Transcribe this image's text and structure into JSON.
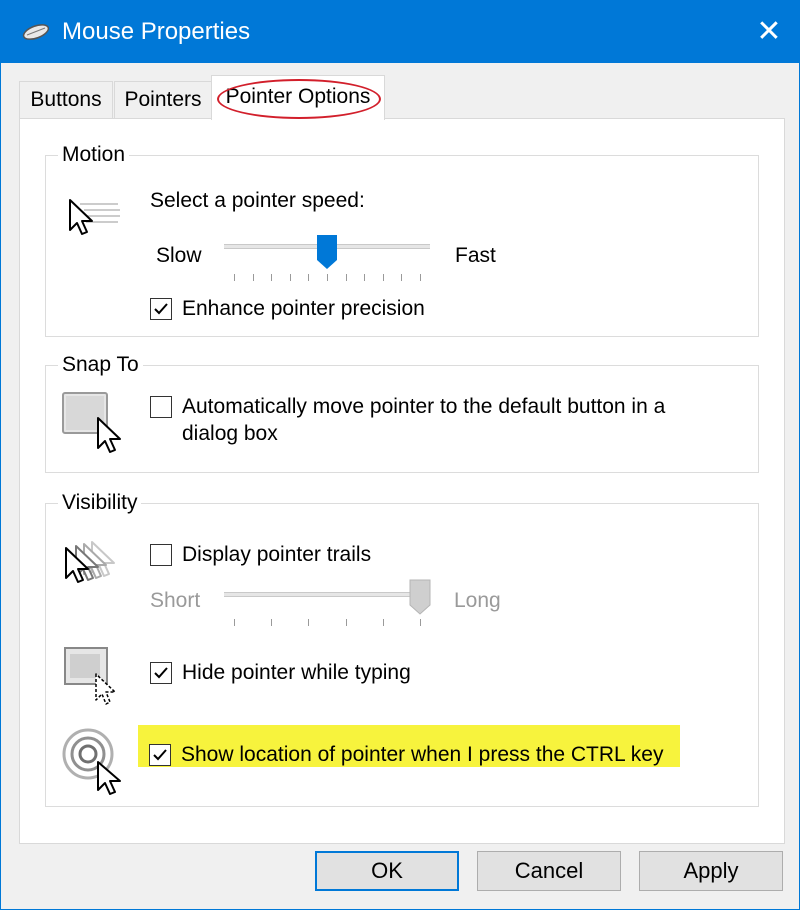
{
  "window": {
    "title": "Mouse Properties",
    "close_glyph": "✕",
    "app_icon": "mouse-icon"
  },
  "tabs": [
    {
      "label": "Buttons",
      "active": false
    },
    {
      "label": "Pointers",
      "active": false
    },
    {
      "label": "Pointer Options",
      "active": true
    }
  ],
  "motion": {
    "group_label": "Motion",
    "speed_label": "Select a pointer speed:",
    "slow_label": "Slow",
    "fast_label": "Fast",
    "speed_level": 0.5,
    "enhance_label": "Enhance pointer precision",
    "enhance_checked": true,
    "icon": "pointer-speed-icon"
  },
  "snap_to": {
    "group_label": "Snap To",
    "auto_move_label_line1": "Automatically move pointer to the default button in a",
    "auto_move_label_line2": "dialog box",
    "auto_move_checked": false,
    "icon": "snap-to-icon"
  },
  "visibility": {
    "group_label": "Visibility",
    "trails_label": "Display pointer trails",
    "trails_checked": false,
    "short_label": "Short",
    "long_label": "Long",
    "trail_level": 1.0,
    "hide_typing_label": "Hide pointer while typing",
    "hide_typing_checked": true,
    "show_location_label": "Show location of pointer when I press the CTRL key",
    "show_location_checked": true,
    "highlight_color": "#f7f33d"
  },
  "accent_color": "#0078d7",
  "annotation_color": "#d21f2b",
  "buttons": {
    "ok": "OK",
    "cancel": "Cancel",
    "apply": "Apply"
  }
}
